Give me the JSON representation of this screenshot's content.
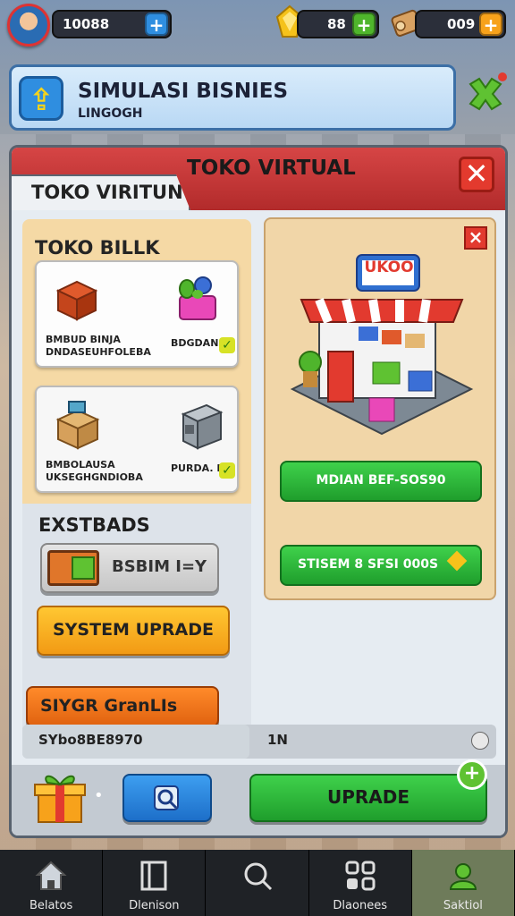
{
  "topbar": {
    "coins": "10088",
    "gems": "88",
    "wood": "009"
  },
  "title": {
    "main": "SIMULASI BISNIES",
    "sub": "LINGOGH"
  },
  "panel": {
    "header_title": "TOKO VIRTUAL",
    "tab_label": "TOKO VIRITUN",
    "close_label": "✕"
  },
  "left": {
    "heading": "TOKO BILLK",
    "card1_text": "BMBUD BINJA\nDNDASEUHFOLEBA",
    "card1_right": "BDGDAN",
    "card2_text": "BMBOLAUSA\nUKSEGHGNDIOBA",
    "card2_right": "PURDA. H"
  },
  "extensions": {
    "heading": "EXSTBADS",
    "button1_label": "BSBIM I=Y",
    "button2_label": "SYSTEM UPRADE",
    "button3_label": "SIYGR GranLIs"
  },
  "right": {
    "shop_sign": "UKOO",
    "btn1_label": "MDIAN BEF-SOS90",
    "btn2_label": "STISEM 8 SFSI 000S"
  },
  "progress": {
    "left_text": "SYbo8BE8970",
    "mid_text": "1N",
    "fill_fraction": 0.48
  },
  "actions": {
    "upgrade_label": "UPRADE",
    "plus_label": "+",
    "dot_label": "•"
  },
  "nav": {
    "items": [
      {
        "label": "Belatos",
        "icon": "home-icon"
      },
      {
        "label": "Dlenison",
        "icon": "book-icon"
      },
      {
        "label": "",
        "icon": "search-icon"
      },
      {
        "label": "Dlaonees",
        "icon": "grid-icon"
      },
      {
        "label": "Saktiol",
        "icon": "profile-icon"
      }
    ]
  },
  "colors": {
    "accent_blue": "#2f8ee0",
    "accent_green": "#28b838",
    "accent_red": "#d64545",
    "accent_orange": "#f7a21b"
  }
}
